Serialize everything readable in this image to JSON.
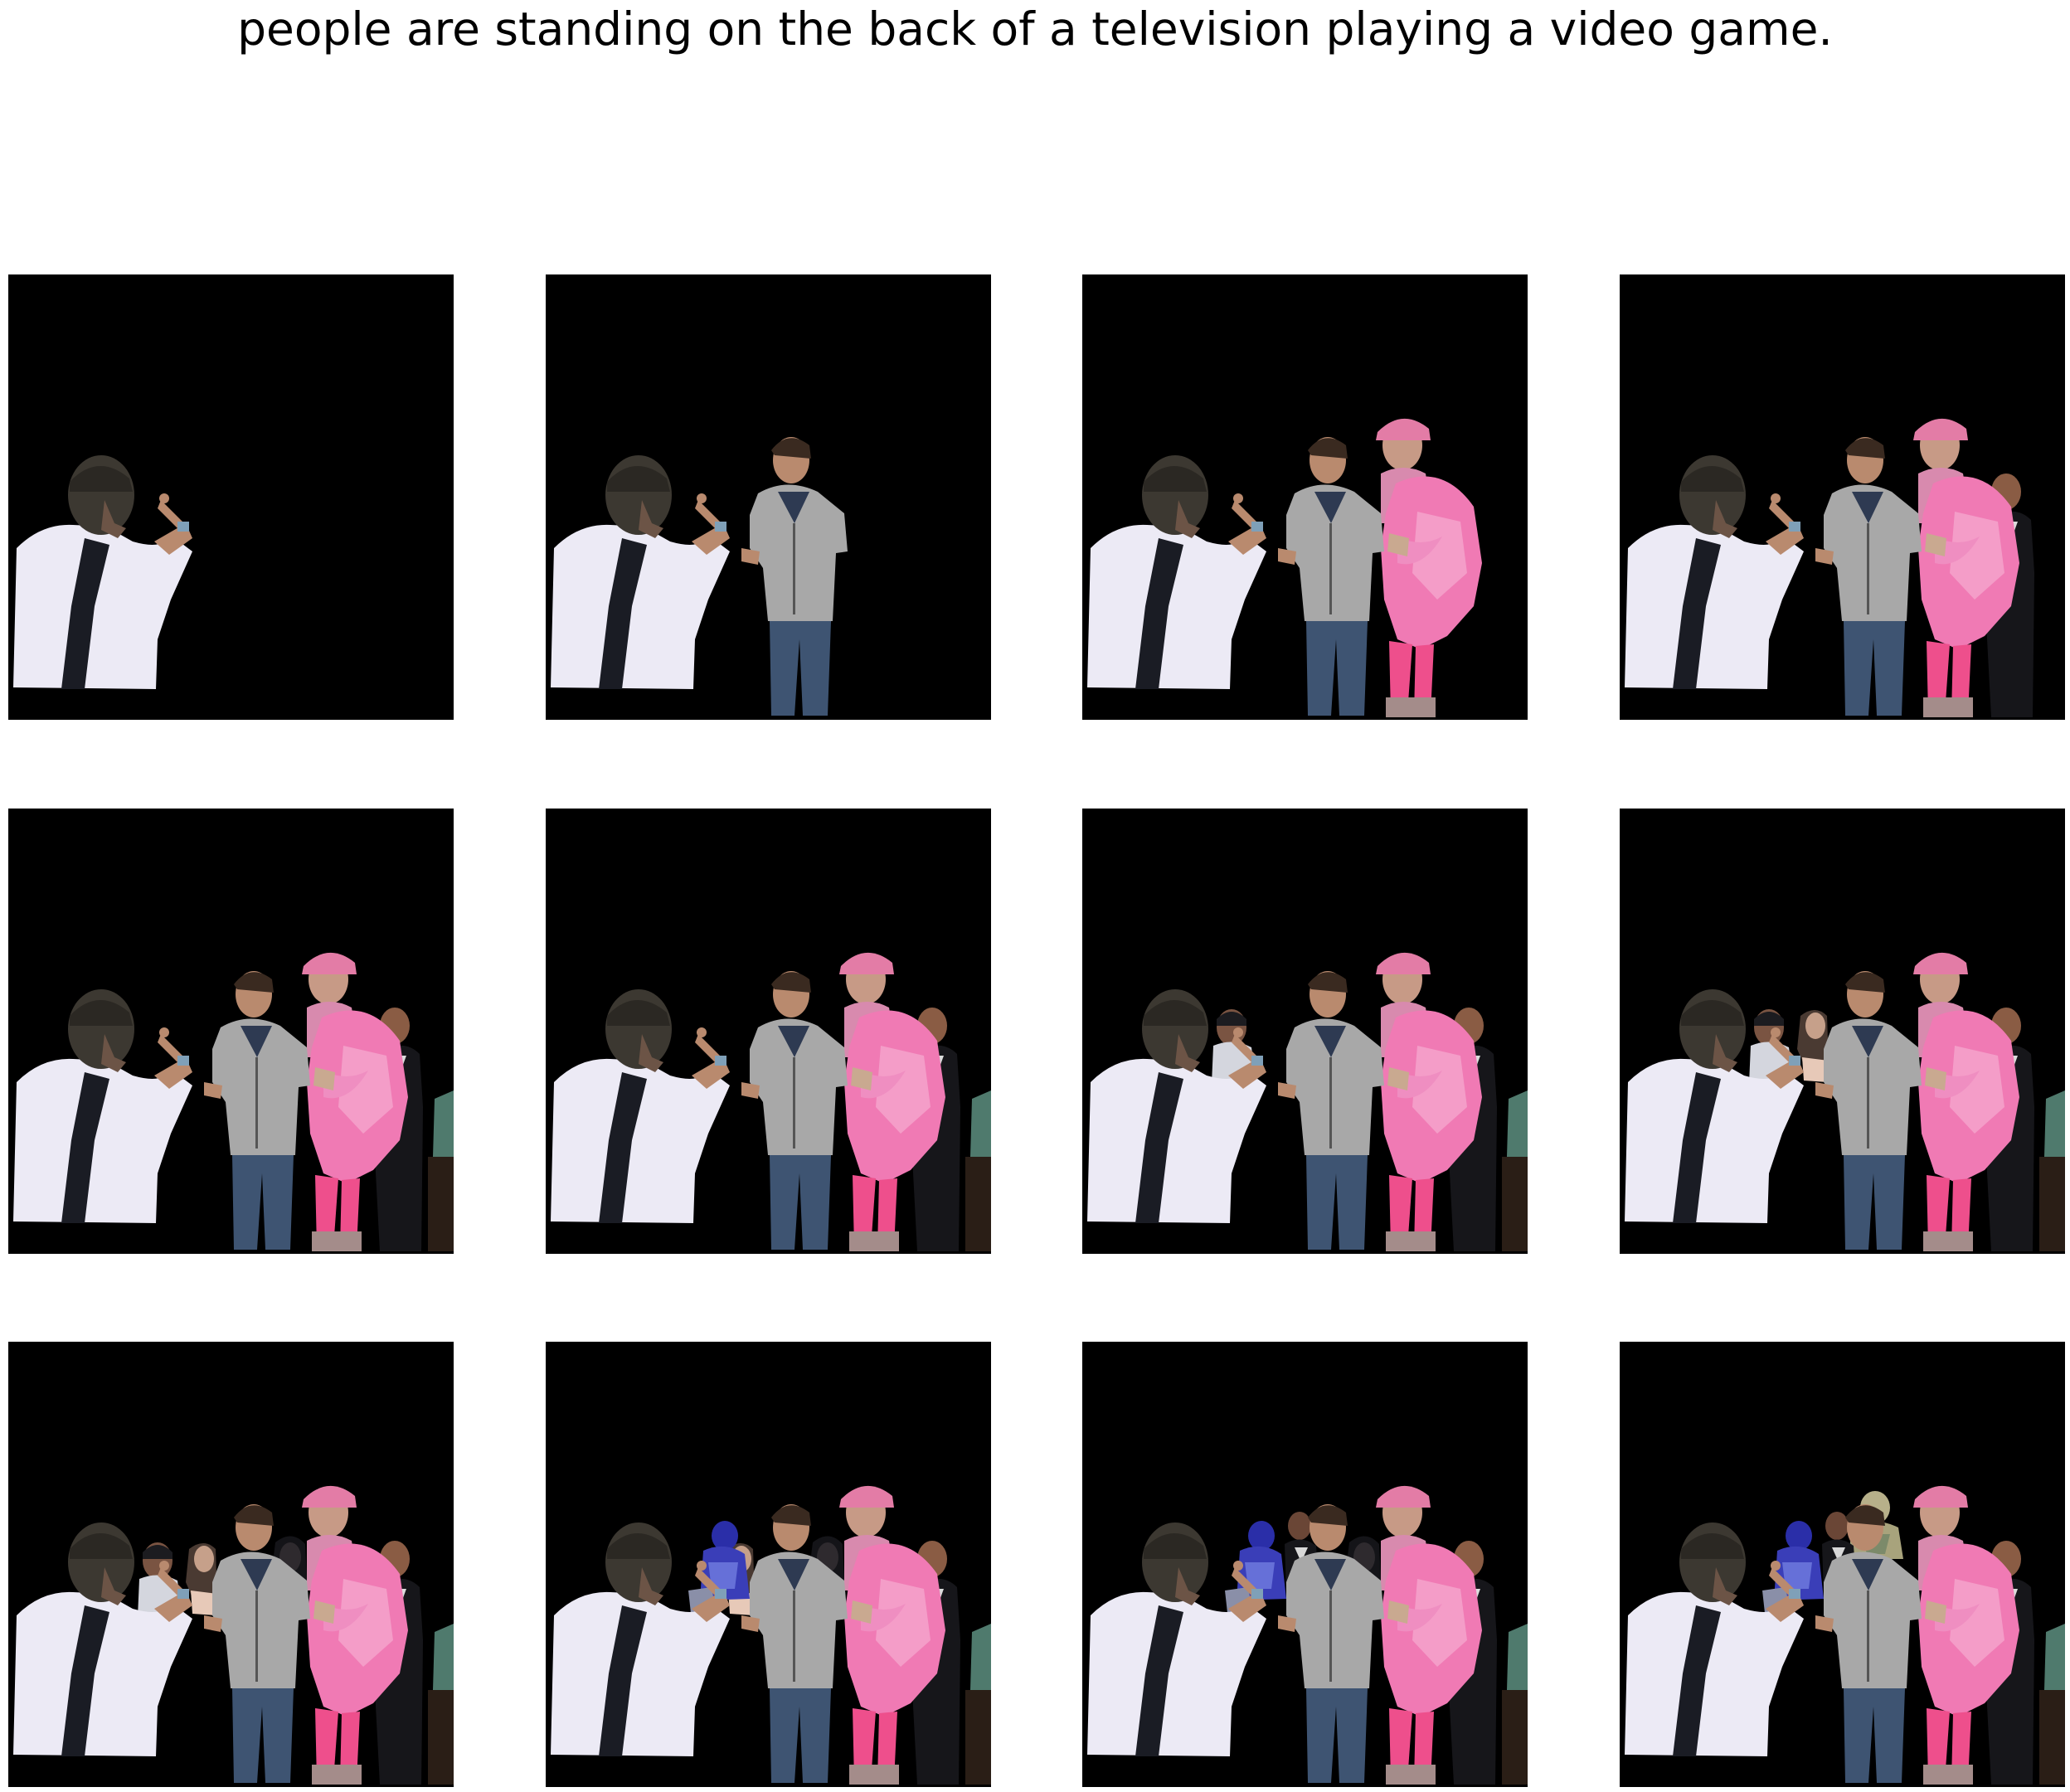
{
  "caption": "people are standing on the back of a television playing a video game.",
  "grid": {
    "rows": 3,
    "cols": 4,
    "background": "#000000"
  },
  "frames": [
    {
      "index": 1,
      "figures": [
        "back-man"
      ]
    },
    {
      "index": 2,
      "figures": [
        "back-man",
        "grey-hoodie-man"
      ]
    },
    {
      "index": 3,
      "figures": [
        "back-man",
        "grey-hoodie-man",
        "pink-coat-person"
      ]
    },
    {
      "index": 4,
      "figures": [
        "back-man",
        "grey-hoodie-man",
        "pink-coat-person",
        "dark-suit-man"
      ]
    },
    {
      "index": 5,
      "figures": [
        "back-man",
        "grey-hoodie-man",
        "pink-coat-person",
        "dark-suit-man",
        "edge-person"
      ]
    },
    {
      "index": 6,
      "figures": [
        "back-man",
        "grey-hoodie-man",
        "pink-coat-person",
        "dark-suit-man",
        "edge-person"
      ]
    },
    {
      "index": 7,
      "figures": [
        "back-man",
        "grey-hoodie-man",
        "pink-coat-person",
        "dark-suit-man",
        "edge-person",
        "small-face-man"
      ]
    },
    {
      "index": 8,
      "figures": [
        "back-man",
        "grey-hoodie-man",
        "pink-coat-person",
        "dark-suit-man",
        "edge-person",
        "small-face-man",
        "woman-bg"
      ]
    },
    {
      "index": 9,
      "figures": [
        "back-man",
        "grey-hoodie-man",
        "pink-coat-person",
        "dark-suit-man",
        "edge-person",
        "small-face-man",
        "woman-bg",
        "dark-hair-person"
      ]
    },
    {
      "index": 10,
      "figures": [
        "back-man",
        "grey-hoodie-man",
        "pink-coat-person",
        "dark-suit-man",
        "edge-person",
        "woman-bg",
        "dark-hair-person",
        "blue-figure"
      ]
    },
    {
      "index": 11,
      "figures": [
        "back-man",
        "grey-hoodie-man",
        "pink-coat-person",
        "dark-suit-man",
        "edge-person",
        "dark-hair-person",
        "blue-figure",
        "suit-man-2"
      ]
    },
    {
      "index": 12,
      "figures": [
        "back-man",
        "grey-hoodie-man",
        "pink-coat-person",
        "dark-suit-man",
        "edge-person",
        "blue-figure",
        "suit-man-2",
        "tan-figure"
      ]
    }
  ],
  "colors": {
    "shirt": "#eceaf5",
    "strap": "#1a1c24",
    "cap": "#3c3831",
    "skin": "#b98a6e",
    "hoodie": "#a8a8a8",
    "jeans": "#3e5472",
    "pink": "#f07ab4",
    "pink_light": "#f4a3cb",
    "hat_pink": "#e37ca6",
    "suit": "#16161a",
    "blue": "#2a2ea8",
    "tan": "#b7b08a",
    "teal": "#4f7a6d"
  }
}
